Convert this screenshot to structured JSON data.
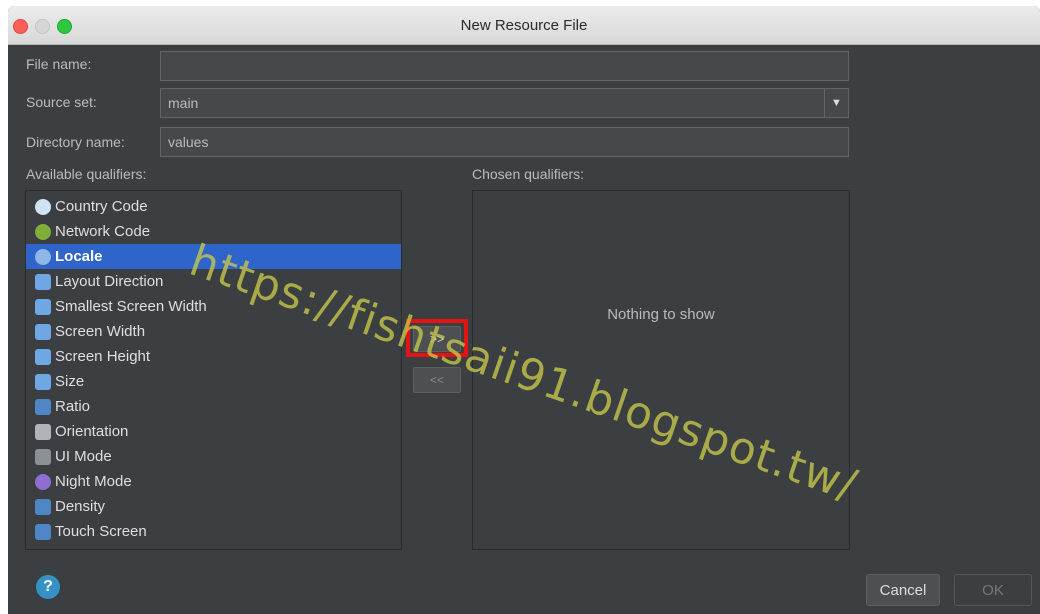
{
  "window": {
    "title": "New Resource File"
  },
  "form": {
    "file_name_label": "File name:",
    "file_name_value": "",
    "source_set_label": "Source set:",
    "source_set_value": "main",
    "directory_label": "Directory name:",
    "directory_value": "values"
  },
  "available": {
    "label": "Available qualifiers:",
    "items": [
      {
        "label": "Country Code",
        "icon": "country-code-icon"
      },
      {
        "label": "Network Code",
        "icon": "network-code-icon"
      },
      {
        "label": "Locale",
        "icon": "locale-globe-icon",
        "selected": true
      },
      {
        "label": "Layout Direction",
        "icon": "layout-direction-icon"
      },
      {
        "label": "Smallest Screen Width",
        "icon": "smallest-width-icon"
      },
      {
        "label": "Screen Width",
        "icon": "screen-width-icon"
      },
      {
        "label": "Screen Height",
        "icon": "screen-height-icon"
      },
      {
        "label": "Size",
        "icon": "size-icon"
      },
      {
        "label": "Ratio",
        "icon": "ratio-icon"
      },
      {
        "label": "Orientation",
        "icon": "orientation-icon"
      },
      {
        "label": "UI Mode",
        "icon": "ui-mode-icon"
      },
      {
        "label": "Night Mode",
        "icon": "night-mode-icon"
      },
      {
        "label": "Density",
        "icon": "density-icon"
      },
      {
        "label": "Touch Screen",
        "icon": "touch-screen-icon"
      }
    ]
  },
  "chosen": {
    "label": "Chosen qualifiers:",
    "empty_text": "Nothing to show"
  },
  "buttons": {
    "add": ">>",
    "remove": "<<",
    "cancel": "Cancel",
    "ok": "OK",
    "help": "?"
  },
  "watermark": "https://fishtsaii91.blogspot.tw/",
  "colors": {
    "selection": "#2f65ca",
    "highlight_box": "#e51414",
    "background": "#3c3f41"
  }
}
